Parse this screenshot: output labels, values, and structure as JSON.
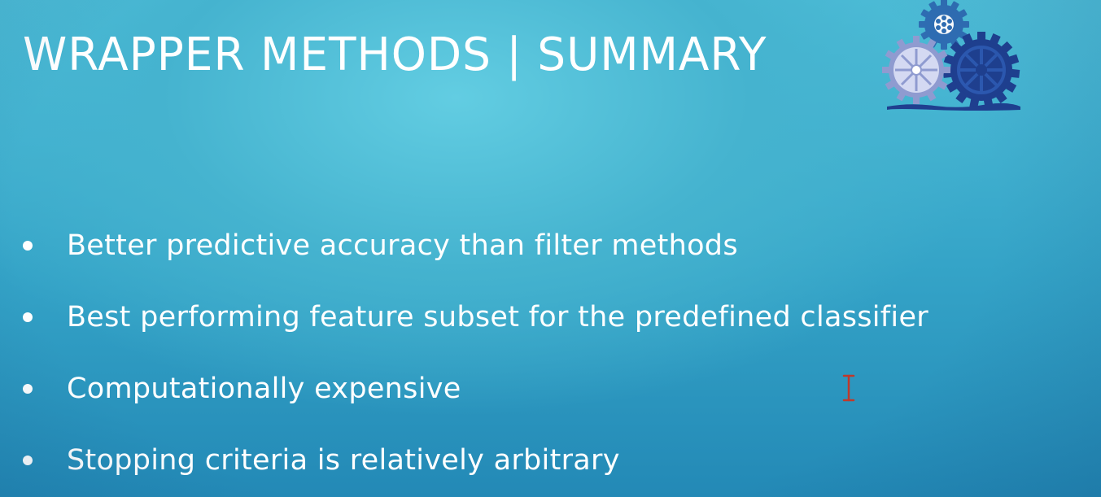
{
  "slide": {
    "title": "WRAPPER METHODS | SUMMARY",
    "bullets": [
      "Better predictive accuracy than filter methods",
      "Best performing feature subset for the predefined classifier",
      "Computationally expensive",
      "Stopping criteria is relatively arbitrary"
    ],
    "decoration_icon": "gears-icon",
    "cursor_icon": "text-cursor-icon"
  },
  "colors": {
    "background_top": "#4fbfd9",
    "background_bottom": "#2389b6",
    "text": "#ffffff",
    "gear_dark": "#1f3f8f",
    "gear_light": "#c8cfee",
    "gear_mid": "#2f6db3",
    "cursor": "#c0392b"
  }
}
